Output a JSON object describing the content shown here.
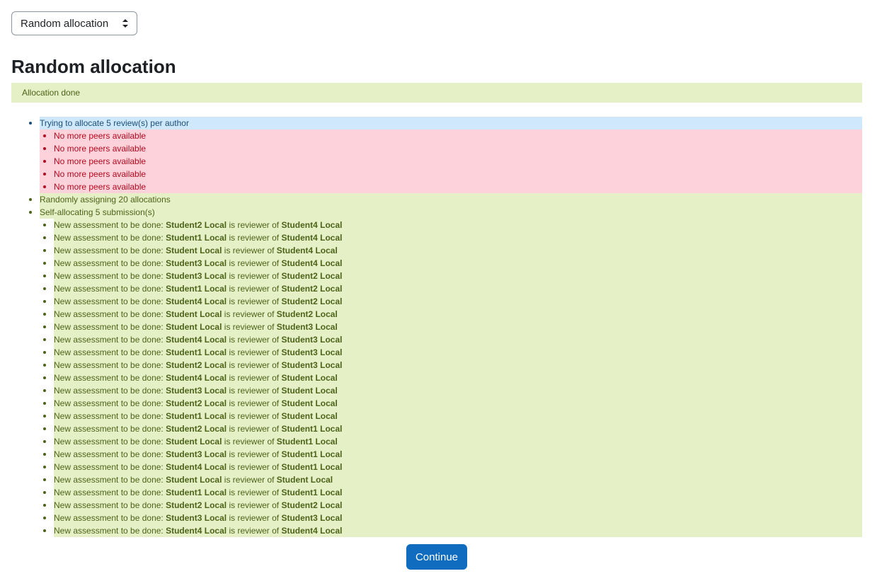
{
  "allocator_select": {
    "value": "Random allocation"
  },
  "page_title": "Random allocation",
  "status_message": "Allocation done",
  "log": [
    {
      "level": 1,
      "type": "info",
      "text": "Trying to allocate 5 review(s) per author"
    },
    {
      "level": 2,
      "type": "error",
      "text": "No more peers available"
    },
    {
      "level": 2,
      "type": "error",
      "text": "No more peers available"
    },
    {
      "level": 2,
      "type": "error",
      "text": "No more peers available"
    },
    {
      "level": 2,
      "type": "error",
      "text": "No more peers available"
    },
    {
      "level": 2,
      "type": "error",
      "text": "No more peers available"
    },
    {
      "level": 1,
      "type": "ok",
      "text": "Randomly assigning 20 allocations"
    },
    {
      "level": 1,
      "type": "ok",
      "text": "Self-allocating 5 submission(s)"
    }
  ],
  "assessments": {
    "prefix": "New assessment to be done:",
    "connector": "is reviewer of",
    "items": [
      {
        "reviewer": "Student2 Local",
        "author": "Student4 Local"
      },
      {
        "reviewer": "Student1 Local",
        "author": "Student4 Local"
      },
      {
        "reviewer": "Student Local",
        "author": "Student4 Local"
      },
      {
        "reviewer": "Student3 Local",
        "author": "Student4 Local"
      },
      {
        "reviewer": "Student3 Local",
        "author": "Student2 Local"
      },
      {
        "reviewer": "Student1 Local",
        "author": "Student2 Local"
      },
      {
        "reviewer": "Student4 Local",
        "author": "Student2 Local"
      },
      {
        "reviewer": "Student Local",
        "author": "Student2 Local"
      },
      {
        "reviewer": "Student Local",
        "author": "Student3 Local"
      },
      {
        "reviewer": "Student4 Local",
        "author": "Student3 Local"
      },
      {
        "reviewer": "Student1 Local",
        "author": "Student3 Local"
      },
      {
        "reviewer": "Student2 Local",
        "author": "Student3 Local"
      },
      {
        "reviewer": "Student4 Local",
        "author": "Student Local"
      },
      {
        "reviewer": "Student3 Local",
        "author": "Student Local"
      },
      {
        "reviewer": "Student2 Local",
        "author": "Student Local"
      },
      {
        "reviewer": "Student1 Local",
        "author": "Student Local"
      },
      {
        "reviewer": "Student2 Local",
        "author": "Student1 Local"
      },
      {
        "reviewer": "Student Local",
        "author": "Student1 Local"
      },
      {
        "reviewer": "Student3 Local",
        "author": "Student1 Local"
      },
      {
        "reviewer": "Student4 Local",
        "author": "Student1 Local"
      },
      {
        "reviewer": "Student Local",
        "author": "Student Local"
      },
      {
        "reviewer": "Student1 Local",
        "author": "Student1 Local"
      },
      {
        "reviewer": "Student2 Local",
        "author": "Student2 Local"
      },
      {
        "reviewer": "Student3 Local",
        "author": "Student3 Local"
      },
      {
        "reviewer": "Student4 Local",
        "author": "Student4 Local"
      }
    ]
  },
  "continue_button": "Continue",
  "colors": {
    "info_bg": "#cfe8fb",
    "error_bg": "#fed2da",
    "success_bg": "#e6f0c6",
    "primary": "#0f6cbf"
  }
}
